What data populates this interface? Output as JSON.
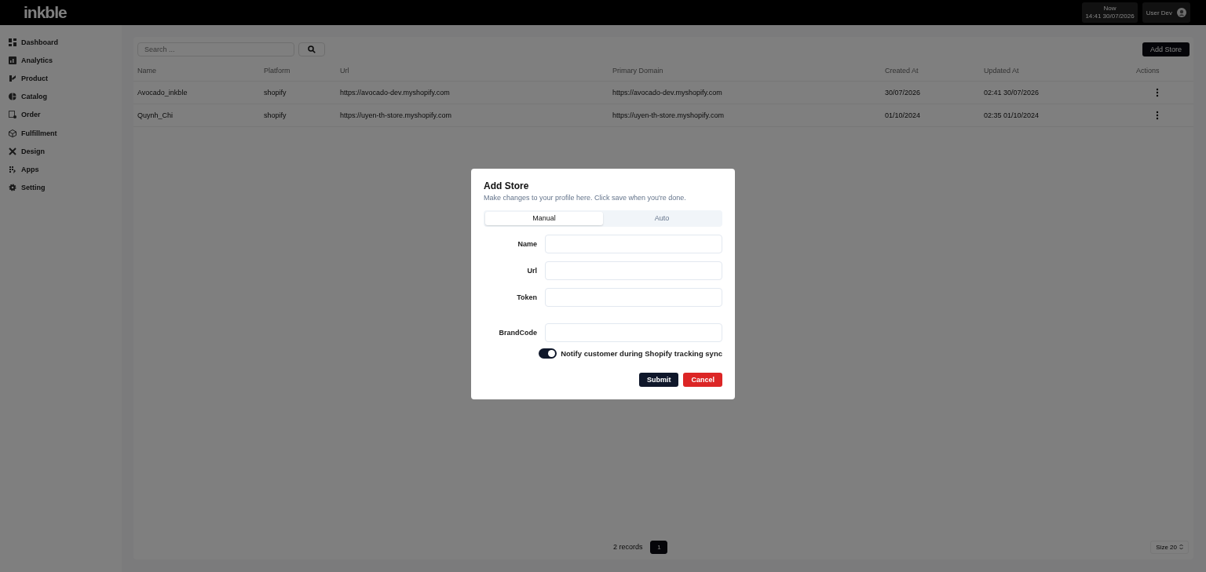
{
  "header": {
    "logo": "inkble",
    "clock_label": "Now",
    "clock_value": "14:41 30/07/2026",
    "user": "User Dev"
  },
  "sidebar": {
    "items": [
      {
        "label": "Dashboard"
      },
      {
        "label": "Analytics"
      },
      {
        "label": "Product"
      },
      {
        "label": "Catalog"
      },
      {
        "label": "Order"
      },
      {
        "label": "Fulfillment"
      },
      {
        "label": "Design"
      },
      {
        "label": "Apps"
      },
      {
        "label": "Setting"
      }
    ]
  },
  "toolbar": {
    "search_placeholder": "Search ...",
    "add_button": "Add Store"
  },
  "table": {
    "columns": [
      "Name",
      "Platform",
      "Url",
      "Primary Domain",
      "Created At",
      "Updated At",
      "Actions"
    ],
    "rows": [
      {
        "cells": [
          "Avocado_inkble",
          "shopify",
          "https://avocado-dev.myshopify.com",
          "https://avocado-dev.myshopify.com",
          "30/07/2026",
          "02:41 30/07/2026"
        ]
      },
      {
        "cells": [
          "Quynh_Chi",
          "shopify",
          "https://uyen-th-store.myshopify.com",
          "https://uyen-th-store.myshopify.com",
          "01/10/2024",
          "02:35 01/10/2024"
        ]
      }
    ]
  },
  "footer": {
    "records": "2 records",
    "pages": [
      {
        "label": "1",
        "selected": true
      }
    ],
    "page_size": "Size 20"
  },
  "dialog": {
    "title": "Add Store",
    "description": "Make changes to your profile here. Click save when you're done.",
    "tabs": [
      {
        "label": "Manual",
        "selected": true
      },
      {
        "label": "Auto",
        "selected": false
      }
    ],
    "fields": [
      {
        "label": "Name"
      },
      {
        "label": "Url"
      },
      {
        "label": "Token"
      },
      {
        "label": "BrandCode"
      }
    ],
    "toggle": {
      "label": "Notify customer during Shopify tracking sync",
      "on": true
    },
    "buttons": [
      {
        "label": "Submit",
        "kind": "primary"
      },
      {
        "label": "Cancel",
        "kind": "danger"
      }
    ]
  }
}
